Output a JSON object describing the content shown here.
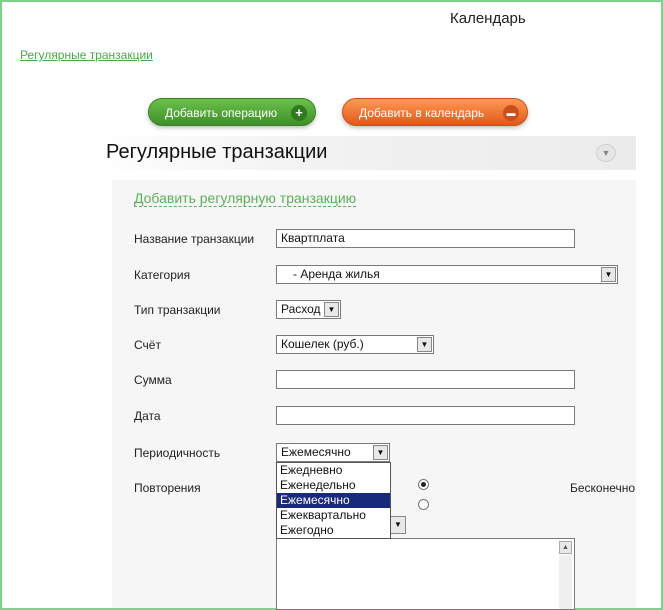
{
  "header": {
    "title": "Календарь"
  },
  "top_link": "Регулярные транзакции",
  "buttons": {
    "add_operation": "Добавить операцию",
    "add_calendar": "Добавить в календарь"
  },
  "section": {
    "title": "Регулярные транзакции"
  },
  "form": {
    "add_link": "Добавить регулярную транзакцию",
    "labels": {
      "name": "Название транзакции",
      "category": "Категория",
      "type": "Тип транзакции",
      "account": "Счёт",
      "amount": "Сумма",
      "date": "Дата",
      "periodicity": "Периодичность",
      "repeats": "Повторения"
    },
    "values": {
      "name": "Квартплата",
      "category": "- Аренда жилья",
      "type": "Расход",
      "account": "Кошелек (руб.)",
      "amount": "",
      "date": "",
      "periodicity": "Ежемесячно"
    },
    "periodicity_options": [
      "Ежедневно",
      "Еженедельно",
      "Ежемесячно",
      "Ежеквартально",
      "Ежегодно"
    ],
    "selected_option_index": 2,
    "repeat_infinite_label": "Бесконечно"
  }
}
